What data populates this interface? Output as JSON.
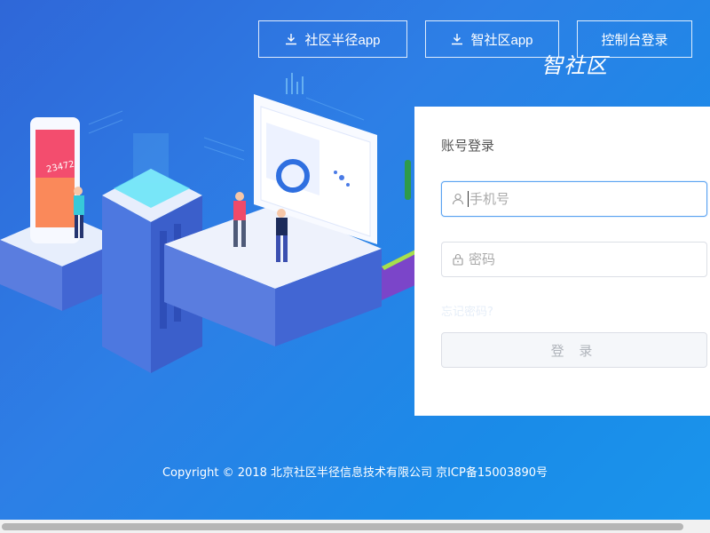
{
  "header": {
    "buttons": [
      {
        "label": "社区半径app",
        "icon": "download-icon"
      },
      {
        "label": "智社区app",
        "icon": "download-icon"
      },
      {
        "label": "控制台登录"
      }
    ],
    "brand": "智社区"
  },
  "illustration": {
    "phone_number": "23472"
  },
  "login": {
    "title": "账号登录",
    "phone_placeholder": "手机号",
    "password_placeholder": "密码",
    "forgot": "忘记密码?",
    "submit": "登 录"
  },
  "footer": {
    "copyright": "Copyright © 2018 北京社区半径信息技术有限公司 京ICP备15003890号"
  },
  "colors": {
    "background_start": "#2f67d8",
    "background_end": "#1a95ec",
    "focus_border": "#5aa2f0"
  }
}
